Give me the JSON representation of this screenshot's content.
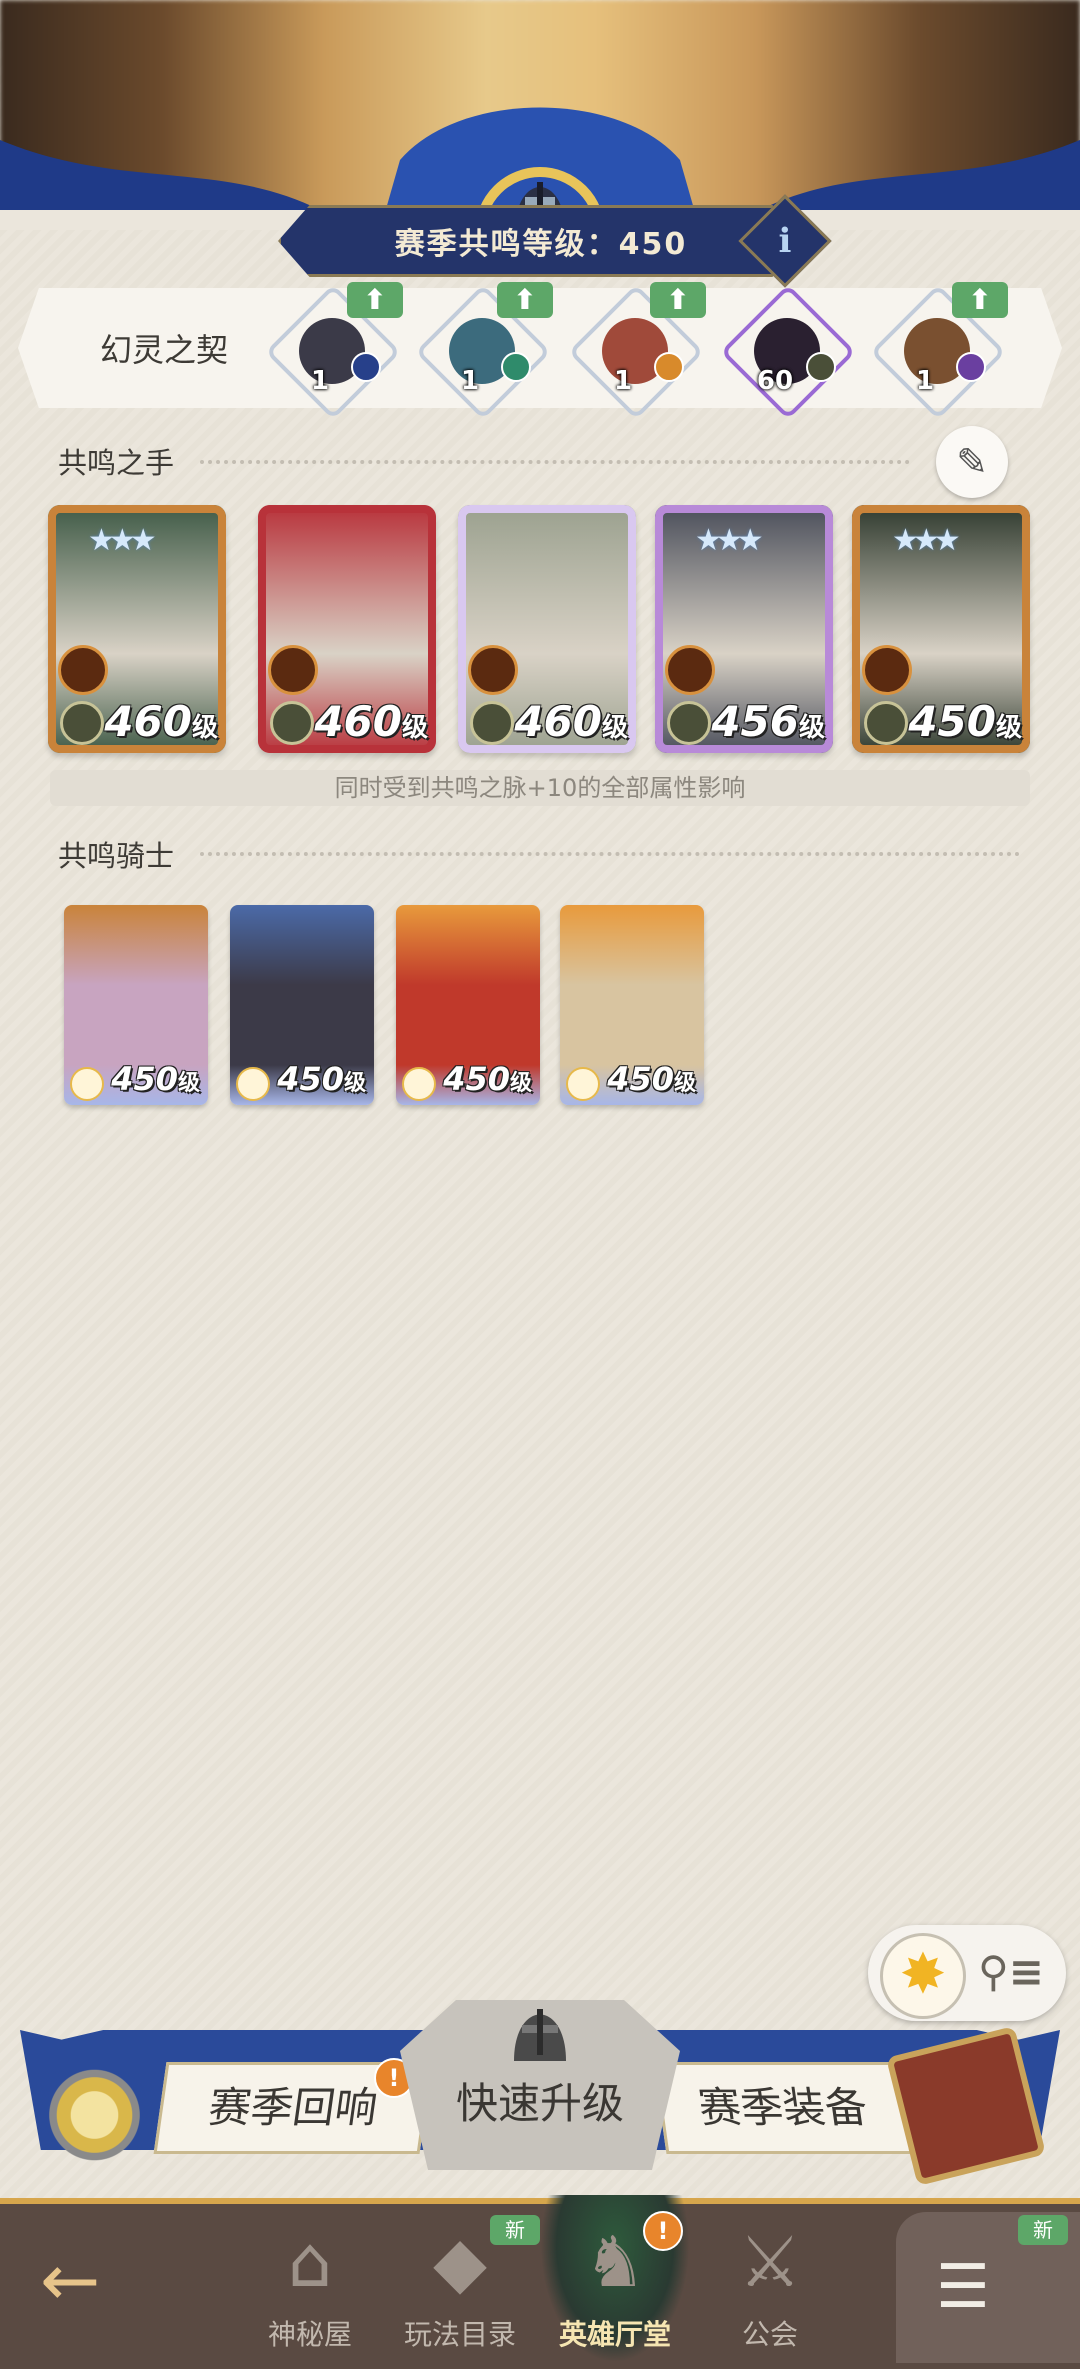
{
  "header": {
    "season_level_label": "赛季共鸣等级：450",
    "info_label": "i"
  },
  "contract": {
    "label": "幻灵之契",
    "slots": [
      {
        "level": "1",
        "up": "⬆",
        "color": "#3b3a48",
        "badge": "#27408a"
      },
      {
        "level": "1",
        "up": "⬆",
        "color": "#3c6b7d",
        "badge": "#2f8b6b"
      },
      {
        "level": "1",
        "up": "⬆",
        "color": "#a04a3a",
        "badge": "#d88a2b"
      },
      {
        "level": "60",
        "up": "",
        "color": "#2a2030",
        "badge": "#4a4f38"
      },
      {
        "level": "1",
        "up": "⬆",
        "color": "#7a5030",
        "badge": "#6a3fa0"
      }
    ]
  },
  "resonance_hands": {
    "title": "共鸣之手",
    "note": "同时受到共鸣之脉+10的全部属性影响",
    "heroes": [
      {
        "level": "460",
        "unit": "级",
        "bg": "#3f5a46",
        "frame": "#c9833a",
        "stars": "★★★"
      },
      {
        "level": "460",
        "unit": "级",
        "bg": "#b8323a",
        "frame": "#b8323a",
        "stars": ""
      },
      {
        "level": "460",
        "unit": "级",
        "bg": "#9aa08e",
        "frame": "#d9c8f0",
        "stars": ""
      },
      {
        "level": "456",
        "unit": "级",
        "bg": "#4a4e5a",
        "frame": "#b88ad8",
        "stars": "★★★"
      },
      {
        "level": "450",
        "unit": "级",
        "bg": "#2f3a2e",
        "frame": "#c9833a",
        "stars": "★★★"
      }
    ]
  },
  "resonance_knights": {
    "title": "共鸣骑士",
    "heroes": [
      {
        "level": "450",
        "unit": "级",
        "bg": "#c8a4c0",
        "frame": "#c9833a"
      },
      {
        "level": "450",
        "unit": "级",
        "bg": "#3c3a48",
        "frame": "#4b6aa8"
      },
      {
        "level": "450",
        "unit": "级",
        "bg": "#c0392b",
        "frame": "#e89a3c"
      },
      {
        "level": "450",
        "unit": "级",
        "bg": "#d8c4a0",
        "frame": "#e89a3c"
      }
    ]
  },
  "actions": {
    "season_echo": "赛季回响",
    "quick_upgrade": "快速升级",
    "season_gear": "赛季装备",
    "alert": "!"
  },
  "nav": {
    "back": "←",
    "items": [
      {
        "label": "神秘屋",
        "icon": "⌂",
        "new": ""
      },
      {
        "label": "玩法目录",
        "icon": "◆",
        "new": "新"
      },
      {
        "label": "英雄厅堂",
        "icon": "♞",
        "new": ""
      },
      {
        "label": "公会",
        "icon": "⚔",
        "new": ""
      }
    ],
    "menu_new": "新",
    "menu_icon": "☰"
  },
  "colors": {
    "accent_gold": "#d7a64c",
    "nav_bg": "#5a4a42",
    "banner_blue": "#24346a",
    "new_green": "#5da768"
  }
}
